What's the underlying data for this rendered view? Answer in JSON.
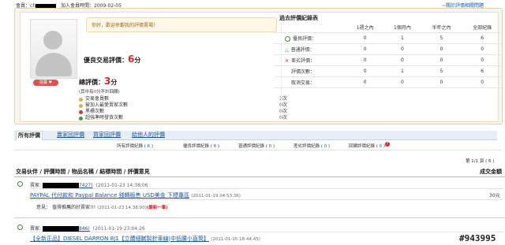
{
  "topbar": {
    "member_label": "會員：",
    "member_name": "ch",
    "join_label": "加入會員時間：2009-02-05",
    "help_link": "~關於評價相關問題"
  },
  "profile": {
    "greeting": "你好，歡迎參觀我的評價賣場！",
    "good_label": "優良交易評價：",
    "good_score": "6",
    "good_unit": "分",
    "total_label": "總評價：",
    "total_score": "3",
    "total_unit": "分",
    "total_note_prefix": "(其中有",
    "total_note_value": "0",
    "total_note_suffix": "分不計回饋)",
    "badge_label": "拍賣"
  },
  "stats": [
    {
      "icon": "person-icon",
      "label": "交易會員數",
      "value": "3次"
    },
    {
      "icon": "person-add-icon",
      "label": "被加入最愛賣家次數",
      "value": "0次"
    },
    {
      "icon": "red-dot-icon",
      "label": "黑標次數",
      "value": "0次"
    },
    {
      "icon": "green-dot-icon",
      "label": "超強準時發貨次數",
      "value": "0次"
    }
  ],
  "history": {
    "title": "過去評價紀錄表",
    "columns": [
      "1週之內",
      "1個月內",
      "半年之內",
      "全部紀錄"
    ],
    "rows": [
      {
        "icon": "circle-good-icon",
        "label": "優良評價：",
        "values": [
          "0",
          "1",
          "5",
          "6"
        ]
      },
      {
        "icon": "triangle-mid-icon",
        "label": "普通評價：",
        "values": [
          "0",
          "0",
          "0",
          "0"
        ]
      },
      {
        "icon": "x-bad-icon",
        "label": "差劣評價：",
        "values": [
          "0",
          "0",
          "0",
          "0"
        ]
      },
      {
        "icon": "",
        "label": "評價次數：",
        "values": [
          "0",
          "1",
          "5",
          "6"
        ]
      },
      {
        "icon": "",
        "label": "取消交易：",
        "values": [
          "0",
          "0",
          "0",
          "0"
        ]
      }
    ]
  },
  "tabs": [
    "所有評價",
    "賣家回評價",
    "買家回評價",
    "給他人的評價"
  ],
  "filters": [
    {
      "label": "所有評價紀錄",
      "count": "6"
    },
    {
      "label": "優良評價紀錄",
      "count": "6"
    },
    {
      "label": "普通評價紀錄",
      "count": "0"
    },
    {
      "label": "差劣評價紀錄",
      "count": "0"
    },
    {
      "label": "回饋評價紀錄",
      "count": "0"
    }
  ],
  "pager": {
    "text": "第 1/1 頁 ( 6 )"
  },
  "list_header": {
    "left": "交易伙伴 / 評價時間 / 物品名稱 / 結標時間 / 評價意見",
    "right": "成交金額"
  },
  "entries": [
    {
      "buyer_label": "賣家:",
      "buyer_suffix": "7427)",
      "time": "(2011-01-23 14:38:06",
      "item": "PAYPAL 代付款和 Paypal Balance 錢轉販售 USD美金 下標專區",
      "end_time": "(2011-01-19 04:53:36)",
      "price": "30元",
      "comment_label": "意見：",
      "comment": "值得推薦的好賣家!!!",
      "comment_time": "(2011-01-23 14:38:00)",
      "comment_flag": "(最新一筆)"
    },
    {
      "buyer_label": "賣家:",
      "buyer_suffix": "846)",
      "time": "(2011-01-19 23:04:26",
      "item": "【全新正品】DIESEL DARRON 8J1【立體細膩製針車線|中低腰小直筒】",
      "end_time": "(2011-01-15 18:44:45)",
      "price": ""
    }
  ],
  "watermark": "#943995"
}
